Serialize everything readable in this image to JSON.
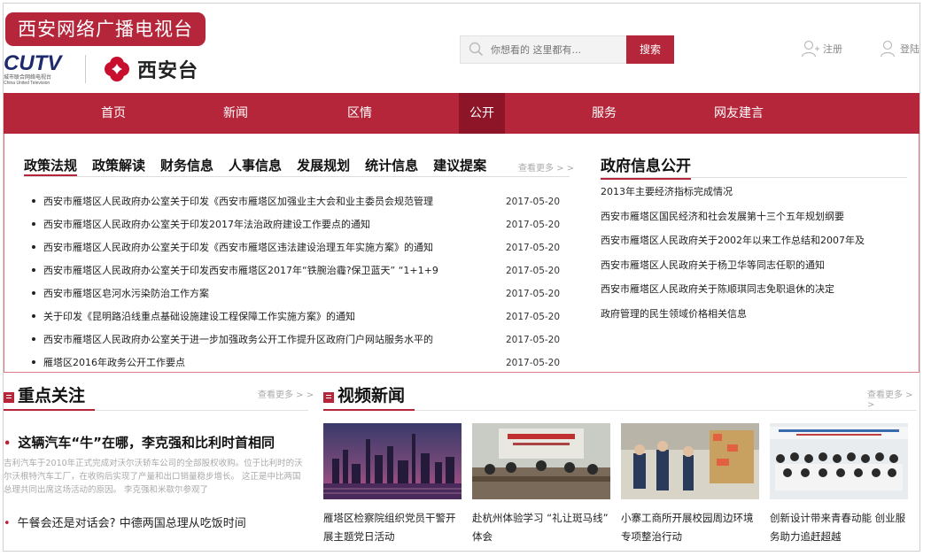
{
  "header": {
    "site_name": "西安网络广播电视台",
    "cutv_logo": "CUTV",
    "cutv_sub_cn": "城市联合网络电视台",
    "cutv_sub_en": "China United Television",
    "station_name": "西安台",
    "search_placeholder": "你想看的 这里都有...",
    "search_button": "搜索",
    "register": "注册",
    "login": "登陆"
  },
  "nav": {
    "items": [
      {
        "label": "首页"
      },
      {
        "label": "新闻"
      },
      {
        "label": "区情"
      },
      {
        "label": "公开"
      },
      {
        "label": "服务"
      },
      {
        "label": "网友建言"
      }
    ],
    "active": "公开"
  },
  "policy": {
    "tabs": [
      "政策法规",
      "政策解读",
      "财务信息",
      "人事信息",
      "发展规划",
      "统计信息",
      "建议提案"
    ],
    "active_tab": "政策法规",
    "more": "查看更多 > >",
    "items": [
      {
        "title": "西安市雁塔区人民政府办公室关于印发《西安市雁塔区加强业主大会和业主委员会规范管理",
        "date": "2017-05-20"
      },
      {
        "title": "西安市雁塔区人民政府办公室关于印发2017年法治政府建设工作要点的通知",
        "date": "2017-05-20"
      },
      {
        "title": "西安市雁塔区人民政府办公室关于印发《西安市雁塔区违法建设治理五年实施方案》的通知",
        "date": "2017-05-20"
      },
      {
        "title": "西安市雁塔区人民政府办公室关于印发西安市雁塔区2017年“铁腕治霾?保卫蓝天” “1+1+9",
        "date": "2017-05-20"
      },
      {
        "title": "西安市雁塔区皂河水污染防治工作方案",
        "date": "2017-05-20"
      },
      {
        "title": "关于印发《昆明路沿线重点基础设施建设工程保障工作实施方案》的通知",
        "date": "2017-05-20"
      },
      {
        "title": "西安市雁塔区人民政府办公室关于进一步加强政务公开工作提升区政府门户网站服务水平的",
        "date": "2017-05-20"
      },
      {
        "title": "雁塔区2016年政务公开工作要点",
        "date": "2017-05-20"
      }
    ]
  },
  "gov": {
    "title": "政府信息公开",
    "items": [
      "2013年主要经济指标完成情况",
      "西安市雁塔区国民经济和社会发展第十三个五年规划纲要",
      "西安市雁塔区人民政府关于2002年以来工作总结和2007年及",
      "西安市雁塔区人民政府关于杨卫华等同志任职的通知",
      "西安市雁塔区人民政府关于陈顺琪同志免职退休的决定",
      "政府管理的民生领域价格相关信息"
    ]
  },
  "focus": {
    "title": "重点关注",
    "more": "查看更多 > >",
    "headline": "这辆汽车“牛”在哪，李克强和比利时首相同",
    "desc": "吉利汽车于2010年正式完成对沃尔沃轿车公司的全部股权收购。位于比利时的沃尔沃根特汽车工厂，在收购后实现了产量和出口销量稳步增长。 这正是中比两国总理共同出席这场活动的原因。 李克强和米歇尔参观了",
    "sub": "午餐会还是对话会? 中德两国总理从吃饭时间"
  },
  "video": {
    "title": "视频新闻",
    "more": "查看更多 > >",
    "items": [
      {
        "caption": "雁塔区检察院组织党员干警开展主题党日活动"
      },
      {
        "caption": "赴杭州体验学习 “礼让斑马线” 体会"
      },
      {
        "caption": "小寨工商所开展校园周边环境专项整治行动"
      },
      {
        "caption": "创新设计带来青春动能 创业服务助力追赶超越"
      }
    ]
  },
  "colors": {
    "brand": "#b5263b",
    "nav_active": "#8e1527"
  }
}
